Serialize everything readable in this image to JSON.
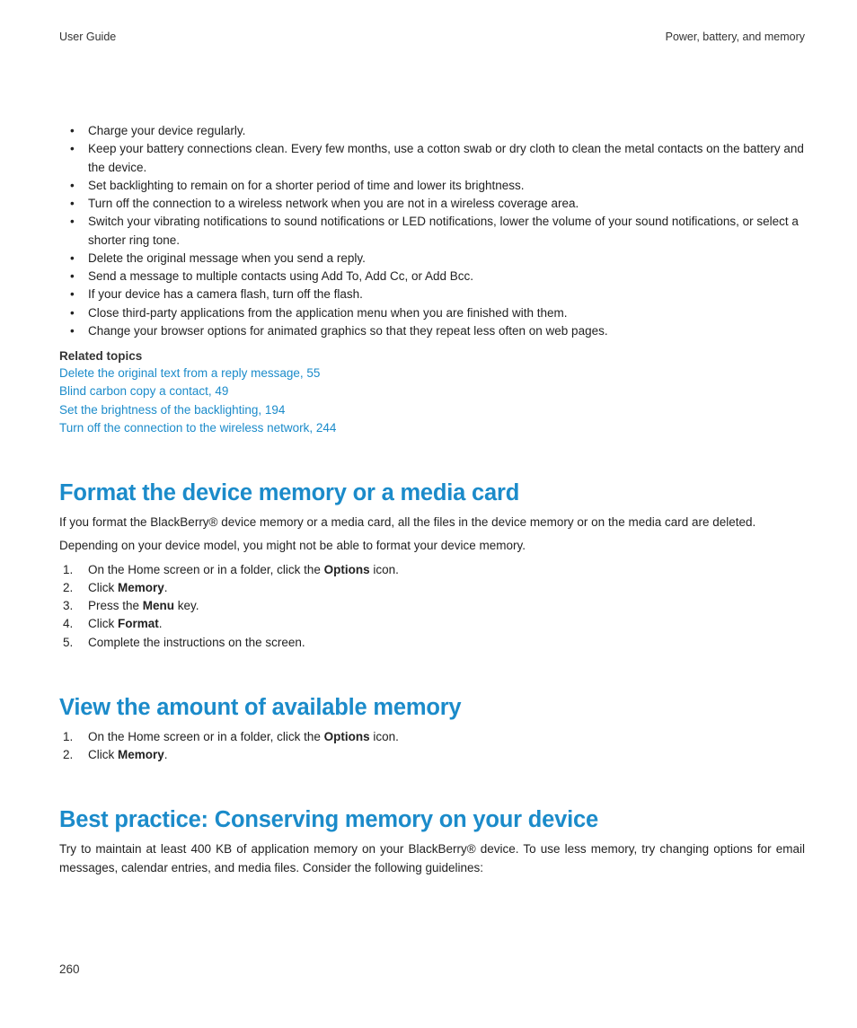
{
  "header": {
    "left": "User Guide",
    "right": "Power, battery, and memory"
  },
  "bullets": [
    "Charge your device regularly.",
    "Keep your battery connections clean. Every few months, use a cotton swab or dry cloth to clean the metal contacts on the battery and the device.",
    "Set backlighting to remain on for a shorter period of time and lower its brightness.",
    "Turn off the connection to a wireless network when you are not in a wireless coverage area.",
    "Switch your vibrating notifications to sound notifications or LED notifications, lower the volume of your sound notifications, or select a shorter ring tone.",
    "Delete the original message when you send a reply.",
    "Send a message to multiple contacts using Add To, Add Cc, or Add Bcc.",
    "If your device has a camera flash, turn off the flash.",
    "Close third-party applications from the application menu when you are finished with them.",
    "Change your browser options for animated graphics so that they repeat less often on web pages."
  ],
  "related": {
    "title": "Related topics",
    "links": [
      "Delete the original text from a reply message, 55",
      "Blind carbon copy a contact, 49",
      "Set the brightness of the backlighting, 194",
      "Turn off the connection to the wireless network, 244"
    ]
  },
  "sec1": {
    "title": "Format the device memory or a media card",
    "p1": "If you format the BlackBerry® device memory or a media card, all the files in the device memory or on the media card are deleted.",
    "p2": "Depending on your device model, you might not be able to format your device memory.",
    "steps_pre": [
      "On the Home screen or in a folder, click the ",
      "Click ",
      "Press the ",
      "Click ",
      "Complete the instructions on the screen."
    ],
    "steps_bold": [
      "Options",
      "Memory",
      "Menu",
      "Format",
      ""
    ],
    "steps_post": [
      " icon.",
      ".",
      " key.",
      ".",
      ""
    ]
  },
  "sec2": {
    "title": "View the amount of available memory",
    "steps_pre": [
      "On the Home screen or in a folder, click the ",
      "Click "
    ],
    "steps_bold": [
      "Options",
      "Memory"
    ],
    "steps_post": [
      " icon.",
      "."
    ]
  },
  "sec3": {
    "title": "Best practice: Conserving memory on your device",
    "p1": "Try to maintain at least 400 KB of application memory on your BlackBerry® device. To use less memory, try changing options for email messages, calendar entries, and media files. Consider the following guidelines:"
  },
  "page_number": "260"
}
